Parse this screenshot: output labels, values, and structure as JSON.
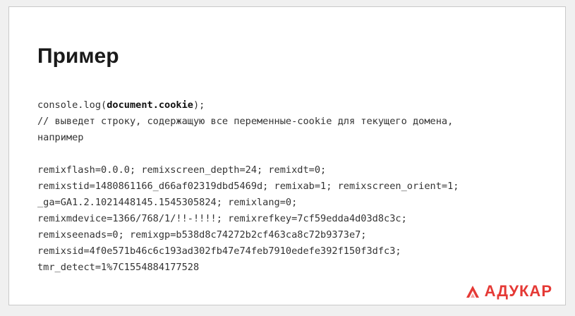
{
  "slide": {
    "title": "Пример",
    "code": {
      "line1": {
        "prefix": "console.log(",
        "bold": "document.cookie",
        "suffix": ");"
      },
      "comment1": "// выведет строку, содержащую все переменные-cookie для текущего домена,",
      "comment2": "например",
      "cookie_lines": [
        "remixflash=0.0.0; remixscreen_depth=24; remixdt=0;",
        "remixstid=1480861166_d66af02319dbd5469d; remixab=1; remixscreen_orient=1;",
        "_ga=GA1.2.1021448145.1545305824; remixlang=0;",
        "remixmdevice=1366/768/1/!!-!!!!; remixrefkey=7cf59edda4d03d8c3c;",
        "remixseenads=0; remixgp=b538d8c74272b2cf463ca8c72b9373e7;",
        "remixsid=4f0e571b46c6c193ad302fb47e74feb7910edefe392f150f3dfc3;",
        "tmr_detect=1%7C1554884177528"
      ]
    }
  },
  "logo": {
    "text": "АДУКАР",
    "color": "#e53935"
  }
}
